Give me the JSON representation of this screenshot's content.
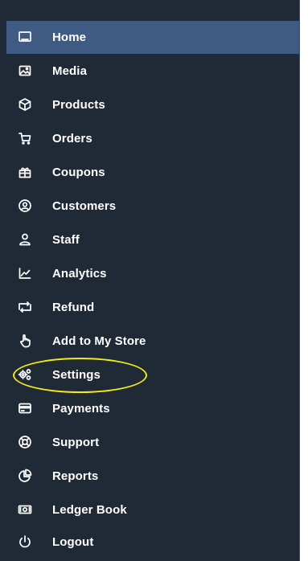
{
  "colors": {
    "sidebar_bg": "#1f2a36",
    "active_bg": "#3f5a83",
    "text": "#ffffff",
    "highlight_ring": "#f2ea1c"
  },
  "sidebar": {
    "active_item": "Home",
    "items": [
      {
        "label": "Home",
        "icon": "monitor-icon"
      },
      {
        "label": "Media",
        "icon": "image-icon"
      },
      {
        "label": "Products",
        "icon": "box-icon"
      },
      {
        "label": "Orders",
        "icon": "cart-icon"
      },
      {
        "label": "Coupons",
        "icon": "gift-icon"
      },
      {
        "label": "Customers",
        "icon": "user-circle-icon"
      },
      {
        "label": "Staff",
        "icon": "user-icon"
      },
      {
        "label": "Analytics",
        "icon": "chart-icon"
      },
      {
        "label": "Refund",
        "icon": "refund-icon"
      },
      {
        "label": "Add to My Store",
        "icon": "hand-pointer-icon"
      },
      {
        "label": "Settings",
        "icon": "gears-icon"
      },
      {
        "label": "Payments",
        "icon": "card-icon"
      },
      {
        "label": "Support",
        "icon": "lifebuoy-icon"
      },
      {
        "label": "Reports",
        "icon": "pie-chart-icon"
      },
      {
        "label": "Ledger Book",
        "icon": "money-icon"
      },
      {
        "label": "Logout",
        "icon": "power-icon"
      }
    ]
  }
}
